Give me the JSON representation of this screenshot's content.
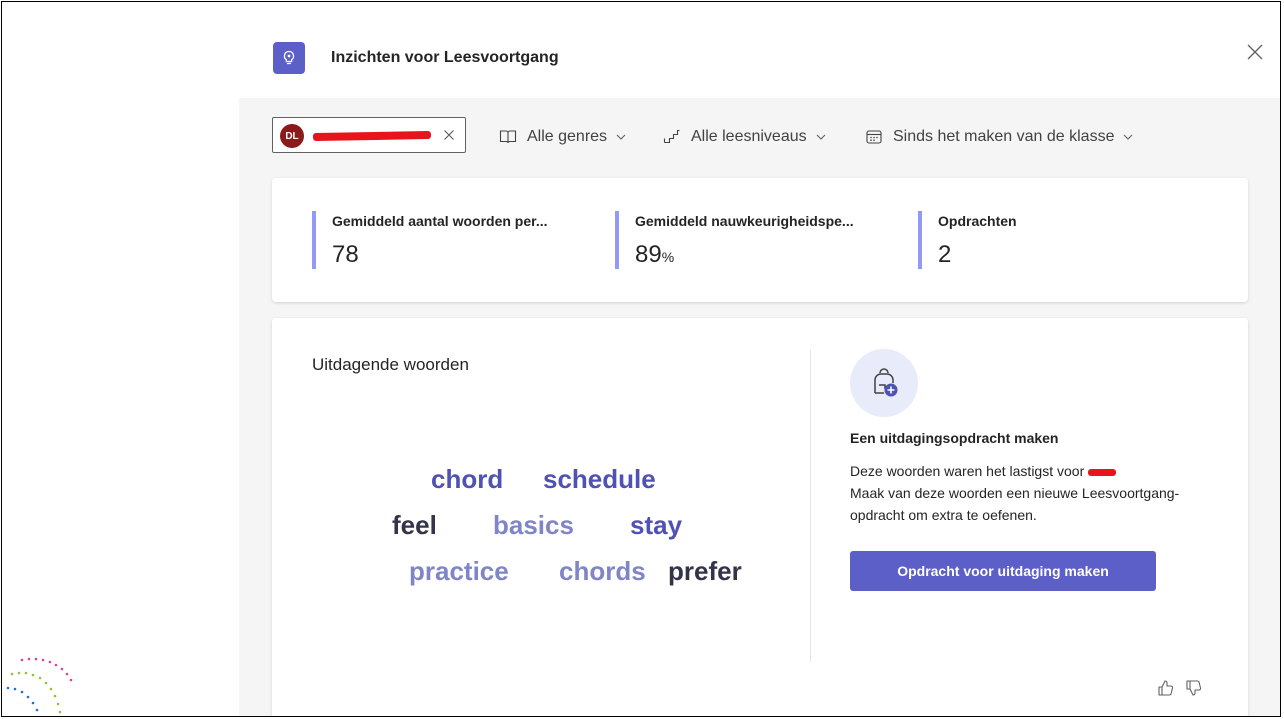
{
  "header": {
    "title": "Inzichten voor Leesvoortgang"
  },
  "filters": {
    "student_initials": "DL",
    "genre_label": "Alle genres",
    "level_label": "Alle leesniveaus",
    "date_label": "Sinds het maken van de klasse"
  },
  "stats": [
    {
      "label": "Gemiddeld aantal woorden per...",
      "value": "78",
      "unit": ""
    },
    {
      "label": "Gemiddeld nauwkeurigheidspe...",
      "value": "89",
      "unit": "%"
    },
    {
      "label": "Opdrachten",
      "value": "2",
      "unit": ""
    }
  ],
  "challenging_words": {
    "title": "Uitdagende woorden",
    "words": [
      {
        "text": "chord",
        "color": "#4f52b2"
      },
      {
        "text": "schedule",
        "color": "#4f52b2"
      },
      {
        "text": "feel",
        "color": "#33344a"
      },
      {
        "text": "basics",
        "color": "#7f85c7"
      },
      {
        "text": "stay",
        "color": "#4f52b2"
      },
      {
        "text": "practice",
        "color": "#7f85c7"
      },
      {
        "text": "chords",
        "color": "#7f85c7"
      },
      {
        "text": "prefer",
        "color": "#33344a"
      }
    ]
  },
  "cta": {
    "title": "Een uitdagingsopdracht maken",
    "description_line1": "Deze woorden waren het lastigst voor",
    "description_line2": "Maak van deze woorden een nieuwe Leesvoortgang-opdracht om extra te oefenen.",
    "button_label": "Opdracht voor uitdaging maken"
  },
  "colors": {
    "accent": "#5b5fc7",
    "stat_bar": "#9299f7",
    "avatar": "#8b1a1a"
  }
}
